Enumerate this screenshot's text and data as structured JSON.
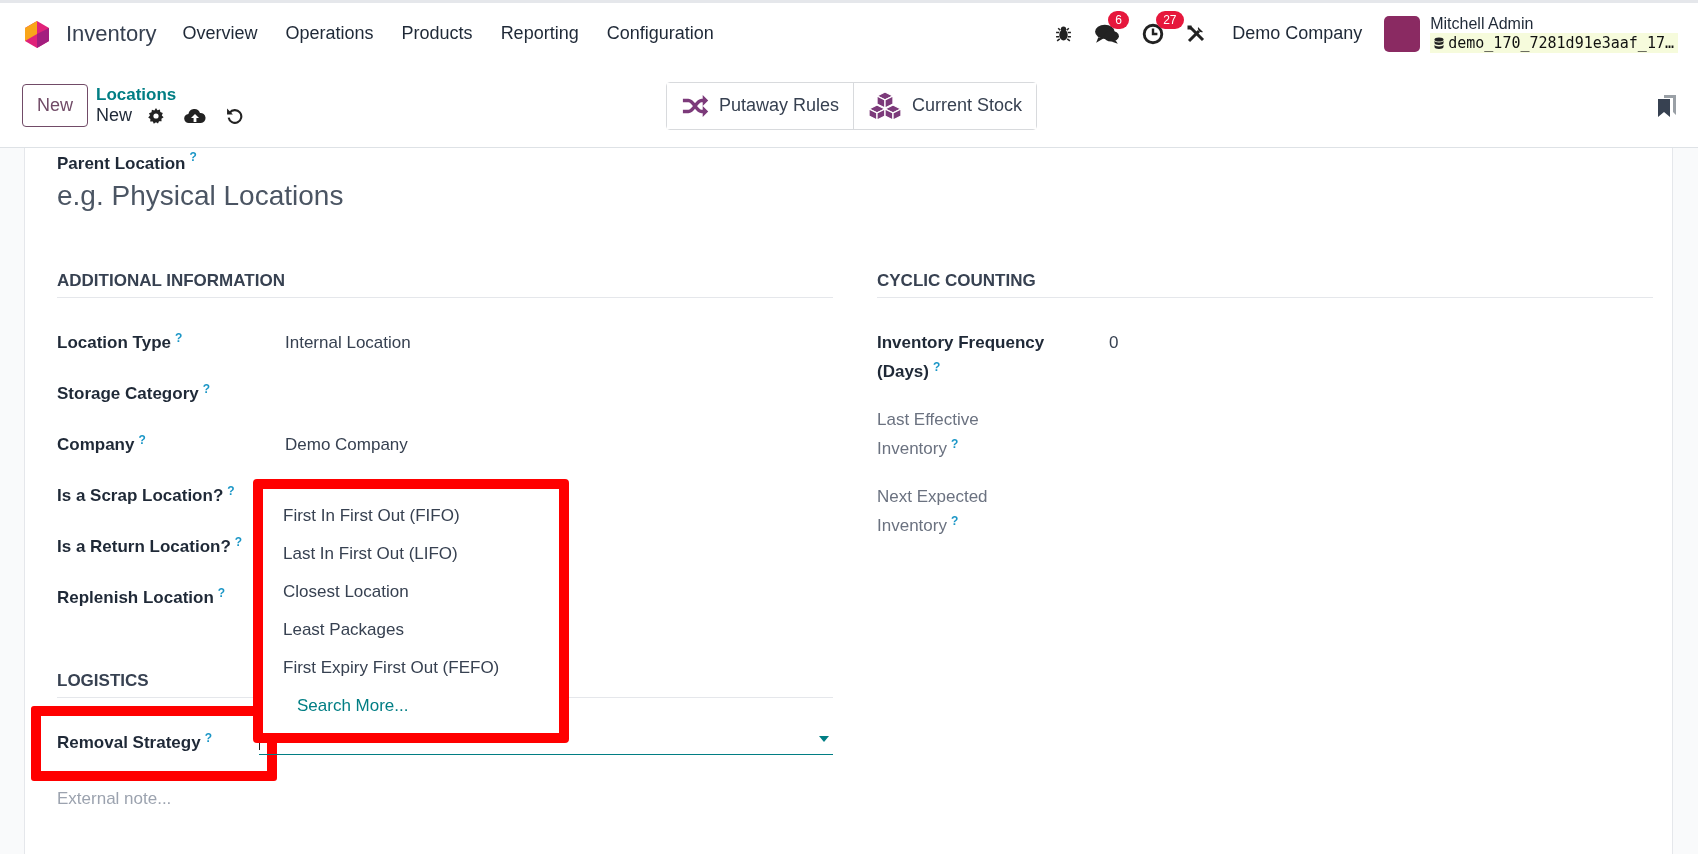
{
  "navbar": {
    "app_name": "Inventory",
    "menu": [
      "Overview",
      "Operations",
      "Products",
      "Reporting",
      "Configuration"
    ],
    "messages_count": "6",
    "activities_count": "27",
    "company": "Demo Company",
    "user_name": "Mitchell Admin",
    "database": "demo_170_7281d91e3aaf_17…"
  },
  "control_panel": {
    "new_button": "New",
    "breadcrumb": "Locations",
    "record": "New",
    "smart_buttons": [
      {
        "label": "Putaway Rules",
        "kind": "shuffle"
      },
      {
        "label": "Current Stock",
        "kind": "cubes"
      }
    ]
  },
  "form": {
    "parent_location": {
      "label": "Parent Location",
      "help": "?",
      "placeholder": "e.g. Physical Locations"
    },
    "sections": [
      {
        "title": "ADDITIONAL INFORMATION",
        "fields": [
          {
            "label": "Location Type",
            "help": "?",
            "readonly": false,
            "value": "Internal Location"
          },
          {
            "label": "Storage Category",
            "help": "?",
            "readonly": false
          },
          {
            "label": "Company",
            "help": "?",
            "readonly": false,
            "value": "Demo Company"
          },
          {
            "label": "Is a Scrap Location?",
            "help": "?",
            "readonly": false
          },
          {
            "label": "Is a Return Location?",
            "help": "?",
            "readonly": false
          },
          {
            "label": "Replenish Location",
            "help": "?",
            "readonly": false
          }
        ]
      },
      {
        "title": "CYCLIC COUNTING",
        "fields": [
          {
            "label": "Inventory Frequency (Days)",
            "help": "?",
            "readonly": false,
            "value": "0"
          },
          {
            "label": "Last Effective Inventory",
            "help": "?",
            "readonly": true
          },
          {
            "label": "Next Expected Inventory",
            "help": "?",
            "readonly": true
          }
        ]
      },
      {
        "title": "LOGISTICS",
        "fields": [
          {
            "label": "Removal Strategy",
            "help": "?",
            "readonly": false,
            "highlighted": true,
            "dropdown": {
              "expanded": true,
              "highlighted": true,
              "options": [
                {
                  "label": "First In First Out (FIFO)",
                  "kind": "option"
                },
                {
                  "label": "Last In First Out (LIFO)",
                  "kind": "option"
                },
                {
                  "label": "Closest Location",
                  "kind": "option"
                },
                {
                  "label": "Least Packages",
                  "kind": "option"
                },
                {
                  "label": "First Expiry First Out (FEFO)",
                  "kind": "option"
                },
                {
                  "label": "Search More...",
                  "kind": "link"
                }
              ]
            }
          }
        ]
      }
    ],
    "external_note": {
      "placeholder": "External note..."
    }
  }
}
